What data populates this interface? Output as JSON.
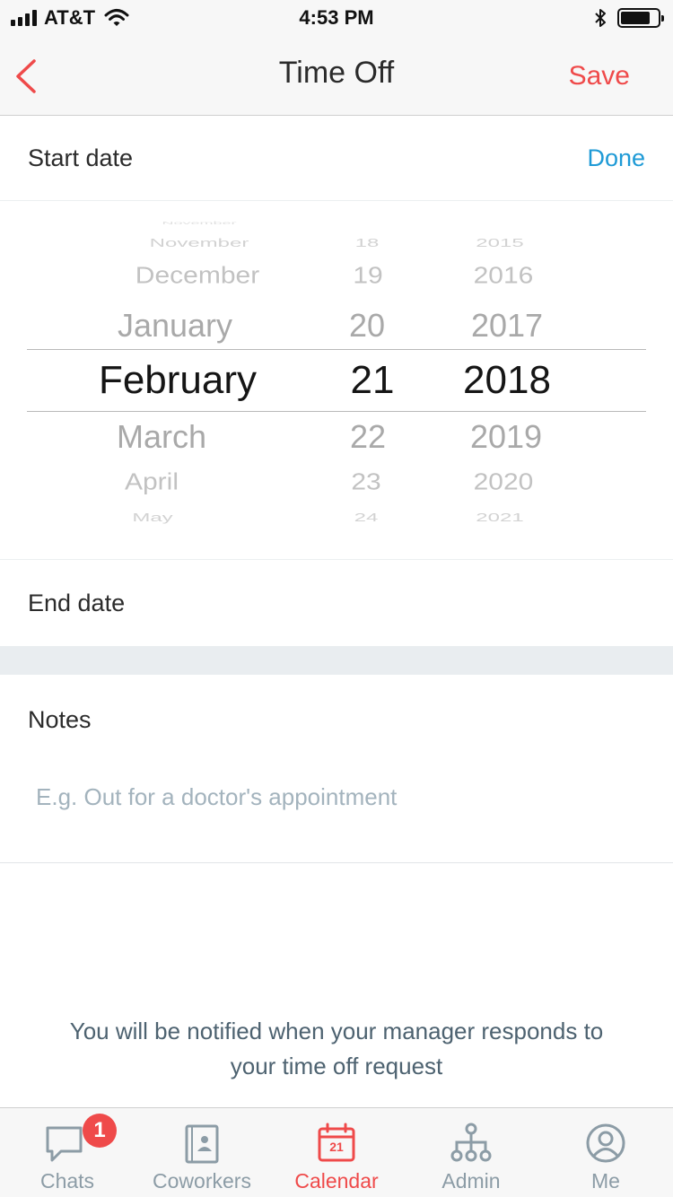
{
  "status_bar": {
    "carrier": "AT&T",
    "time": "4:53 PM",
    "icons": [
      "signal-icon",
      "wifi-icon",
      "bluetooth-icon",
      "battery-icon"
    ]
  },
  "nav": {
    "title": "Time Off",
    "save_label": "Save",
    "back_icon": "chevron-left-icon"
  },
  "start_date": {
    "label": "Start date",
    "done_label": "Done"
  },
  "picker": {
    "month": {
      "above": [
        "November",
        "December",
        "January"
      ],
      "selected": "February",
      "below": [
        "March",
        "April",
        "May"
      ]
    },
    "day": {
      "above": [
        "18",
        "19",
        "20"
      ],
      "selected": "21",
      "below": [
        "22",
        "23",
        "24"
      ]
    },
    "year": {
      "above": [
        "2015",
        "2016",
        "2017"
      ],
      "selected": "2018",
      "below": [
        "2019",
        "2020",
        "2021"
      ]
    }
  },
  "end_date": {
    "label": "End date"
  },
  "notes": {
    "label": "Notes",
    "placeholder": "E.g. Out for a doctor's appointment",
    "value": ""
  },
  "footer": {
    "line1": "You will be notified when your manager responds to",
    "line2": "your time off request"
  },
  "tabbar": {
    "tabs": [
      {
        "label": "Chats",
        "icon": "chat-bubble-icon",
        "badge": "1"
      },
      {
        "label": "Coworkers",
        "icon": "contacts-book-icon"
      },
      {
        "label": "Calendar",
        "icon": "calendar-icon",
        "icon_text": "21",
        "active": true
      },
      {
        "label": "Admin",
        "icon": "org-chart-icon"
      },
      {
        "label": "Me",
        "icon": "profile-icon"
      }
    ]
  },
  "colors": {
    "accent_red": "#ef4a4a",
    "link_blue": "#1e9ad6",
    "muted_text": "#8c9ca6",
    "placeholder": "#a3b3bd"
  }
}
